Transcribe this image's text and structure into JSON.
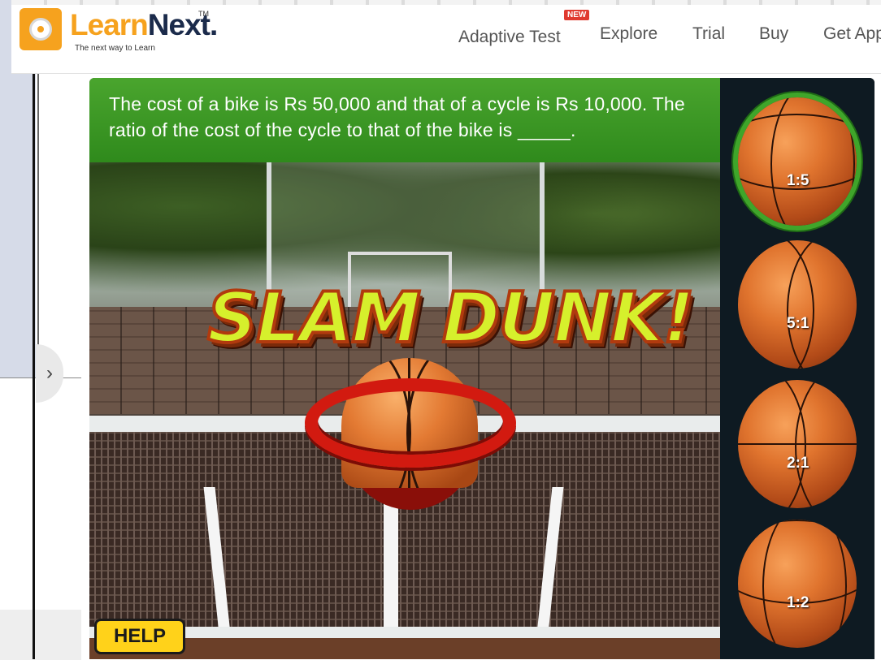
{
  "header": {
    "logo": {
      "brand_part1": "Learn",
      "brand_part2": "Next.",
      "tm": "TM",
      "tagline": "The next way to Learn"
    },
    "nav": [
      {
        "label": "Adaptive Test",
        "badge": "NEW"
      },
      {
        "label": "Explore"
      },
      {
        "label": "Trial"
      },
      {
        "label": "Buy"
      },
      {
        "label": "Get App"
      }
    ]
  },
  "game": {
    "question": "The cost of a bike is Rs 50,000 and that of a cycle is Rs 10,000. The ratio of the cost of the cycle to that of the bike is _____.",
    "title": "SLAM DUNK!",
    "help_label": "HELP",
    "choices": [
      {
        "label": "1:5",
        "selected": true
      },
      {
        "label": "5:1",
        "selected": false
      },
      {
        "label": "2:1",
        "selected": false
      },
      {
        "label": "1:2",
        "selected": false
      }
    ],
    "colors": {
      "question_bg": "#3a9a24",
      "choice_highlight": "#3fa52a",
      "help_bg": "#ffd21a",
      "brand_orange": "#f6a21e"
    }
  },
  "sidebar": {
    "collapse_icon": "chevron-right-icon",
    "collapse_glyph": "›"
  }
}
